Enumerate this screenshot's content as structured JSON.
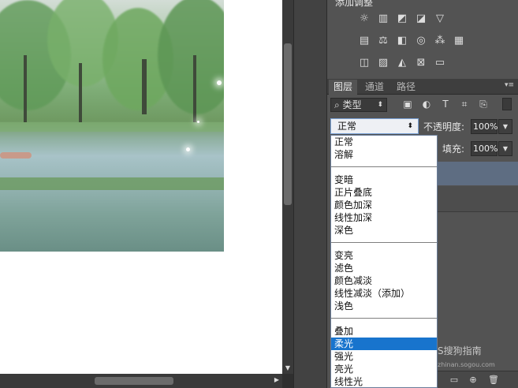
{
  "adjustments": {
    "title": "添加调整",
    "row1": [
      "brightness-icon",
      "levels-icon",
      "curves-icon",
      "exposure-icon",
      "gradient-triangle-icon"
    ],
    "row2": [
      "vibrance-icon",
      "color-balance-icon",
      "black-white-icon",
      "photo-filter-icon",
      "channel-mixer-icon",
      "color-lookup-icon"
    ],
    "row3": [
      "invert-icon",
      "posterize-icon",
      "threshold-icon",
      "selective-color-icon",
      "gradient-map-icon"
    ]
  },
  "layers_panel": {
    "tabs": [
      {
        "label": "图层",
        "active": true
      },
      {
        "label": "通道",
        "active": false
      },
      {
        "label": "路径",
        "active": false
      }
    ],
    "filter": {
      "label": "类型"
    },
    "blend_mode": {
      "value": "正常"
    },
    "opacity": {
      "label": "不透明度:",
      "value": "100%"
    },
    "fill": {
      "label": "填充:",
      "value": "100%"
    }
  },
  "blend_list": {
    "groups": [
      [
        "正常",
        "溶解"
      ],
      [
        "变暗",
        "正片叠底",
        "颜色加深",
        "线性加深",
        "深色"
      ],
      [
        "变亮",
        "滤色",
        "颜色减淡",
        "线性减淡（添加）",
        "浅色"
      ],
      [
        "叠加",
        "柔光",
        "强光",
        "亮光",
        "线性光"
      ]
    ],
    "selected": "柔光"
  },
  "watermark": {
    "text": "S搜狗指南",
    "sub": "zhinan.sogou.com"
  },
  "colors": {
    "selection": "#1874cd",
    "panel": "#535353",
    "layer_selected": "#5e6d82"
  }
}
